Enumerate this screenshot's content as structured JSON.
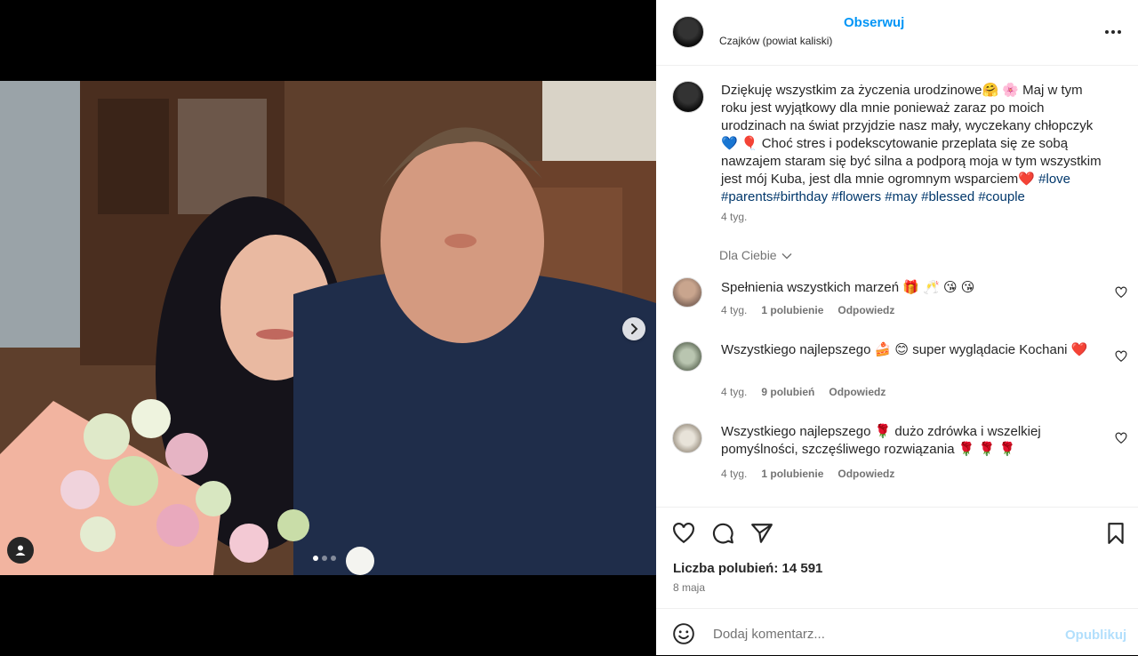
{
  "header": {
    "follow_label": "Obserwuj",
    "location": "Czajków (powiat kaliski)"
  },
  "caption": {
    "text": "Dziękuję wszystkim za życzenia urodzinowe🤗 🌸 Maj w tym roku jest wyjątkowy dla mnie ponieważ zaraz po moich urodzinach na świat przyjdzie nasz mały, wyczekany chłopczyk💙 🎈 Choć stres i podekscytowanie przeplata się ze sobą nawzajem staram się być silna a podporą moja w tym wszystkim jest mój Kuba, jest dla mnie ogromnym wsparciem❤️",
    "hashtags": "#love #parents#birthday #flowers #may #blessed #couple",
    "time": "4 tyg."
  },
  "for_you_label": "Dla Ciebie",
  "comments": [
    {
      "text": "Spełnienia wszystkich marzeń 🎁 🥂 😘 😘",
      "time": "4 tyg.",
      "likes": "1 polubienie",
      "reply": "Odpowiedz"
    },
    {
      "text": "Wszystkiego najlepszego 🍰 😊 super wyglądacie Kochani ❤️",
      "time": "4 tyg.",
      "likes": "9 polubień",
      "reply": "Odpowiedz"
    },
    {
      "text": "Wszystkiego najlepszego 🌹 dużo zdrówka i wszelkiej pomyślności, szczęśliwego rozwiązania 🌹 🌹 🌹",
      "time": "4 tyg.",
      "likes": "1 polubienie",
      "reply": "Odpowiedz"
    }
  ],
  "likes_label": "Liczba polubień: 14 591",
  "post_date": "8 maja",
  "add_comment": {
    "placeholder": "Dodaj komentarz...",
    "publish_label": "Opublikuj"
  },
  "carousel": {
    "count": 3,
    "active": 1
  },
  "colors": {
    "accent": "#0095f6",
    "hashtag": "#00376b",
    "muted": "#737373",
    "publish_disabled": "#b2dffc"
  }
}
